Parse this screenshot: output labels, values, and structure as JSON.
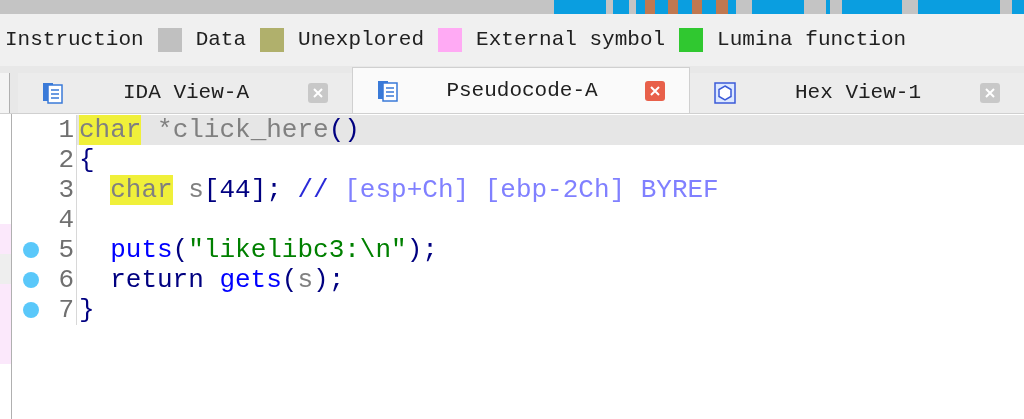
{
  "legend": [
    {
      "label": "Instruction"
    },
    {
      "label": "Data",
      "color": "#c0c0c0"
    },
    {
      "label": "Unexplored",
      "color": "#b0b06c"
    },
    {
      "label": "External symbol",
      "color": "#ffaaf4"
    },
    {
      "label": "Lumina function",
      "color": "#30c830"
    }
  ],
  "tabs": [
    {
      "label": "IDA View-A",
      "kind": "listing",
      "selected": false
    },
    {
      "label": "Pseudocode-A",
      "kind": "listing",
      "selected": true
    },
    {
      "label": "Hex View-1",
      "kind": "hex",
      "selected": false
    }
  ],
  "code_lines": [
    {
      "number": "1",
      "selected": true,
      "breakpoint": false,
      "tokens": [
        {
          "kind": "type",
          "text": "char"
        },
        {
          "kind": "plain",
          "text": " *click_here"
        },
        {
          "kind": "punct",
          "text": "()"
        }
      ]
    },
    {
      "number": "2",
      "selected": false,
      "breakpoint": false,
      "tokens": [
        {
          "kind": "punct",
          "text": "{"
        }
      ]
    },
    {
      "number": "3",
      "selected": false,
      "breakpoint": false,
      "indent": true,
      "tokens": [
        {
          "kind": "type",
          "text": "char"
        },
        {
          "kind": "plain",
          "text": " s"
        },
        {
          "kind": "punct",
          "text": "[44];"
        },
        {
          "kind": "comment",
          "text": " // "
        },
        {
          "kind": "annotation",
          "text": "[esp+Ch] [ebp-2Ch] BYREF"
        }
      ]
    },
    {
      "number": "4",
      "selected": false,
      "breakpoint": false
    },
    {
      "number": "5",
      "selected": false,
      "breakpoint": true,
      "indent": true,
      "tokens": [
        {
          "kind": "func",
          "text": "puts"
        },
        {
          "kind": "punct",
          "text": "("
        },
        {
          "kind": "string",
          "text": "\"likelibc3:\\n\""
        },
        {
          "kind": "punct",
          "text": ");"
        }
      ]
    },
    {
      "number": "6",
      "selected": false,
      "breakpoint": true,
      "indent": true,
      "tokens": [
        {
          "kind": "keyword",
          "text": "return"
        },
        {
          "kind": "func",
          "text": "gets",
          "space_before": true
        },
        {
          "kind": "punct",
          "text": "("
        },
        {
          "kind": "plain",
          "text": "s"
        },
        {
          "kind": "punct",
          "text": ");"
        }
      ]
    },
    {
      "number": "7",
      "selected": false,
      "breakpoint": true,
      "tokens": [
        {
          "kind": "punct",
          "text": "}"
        }
      ]
    }
  ]
}
